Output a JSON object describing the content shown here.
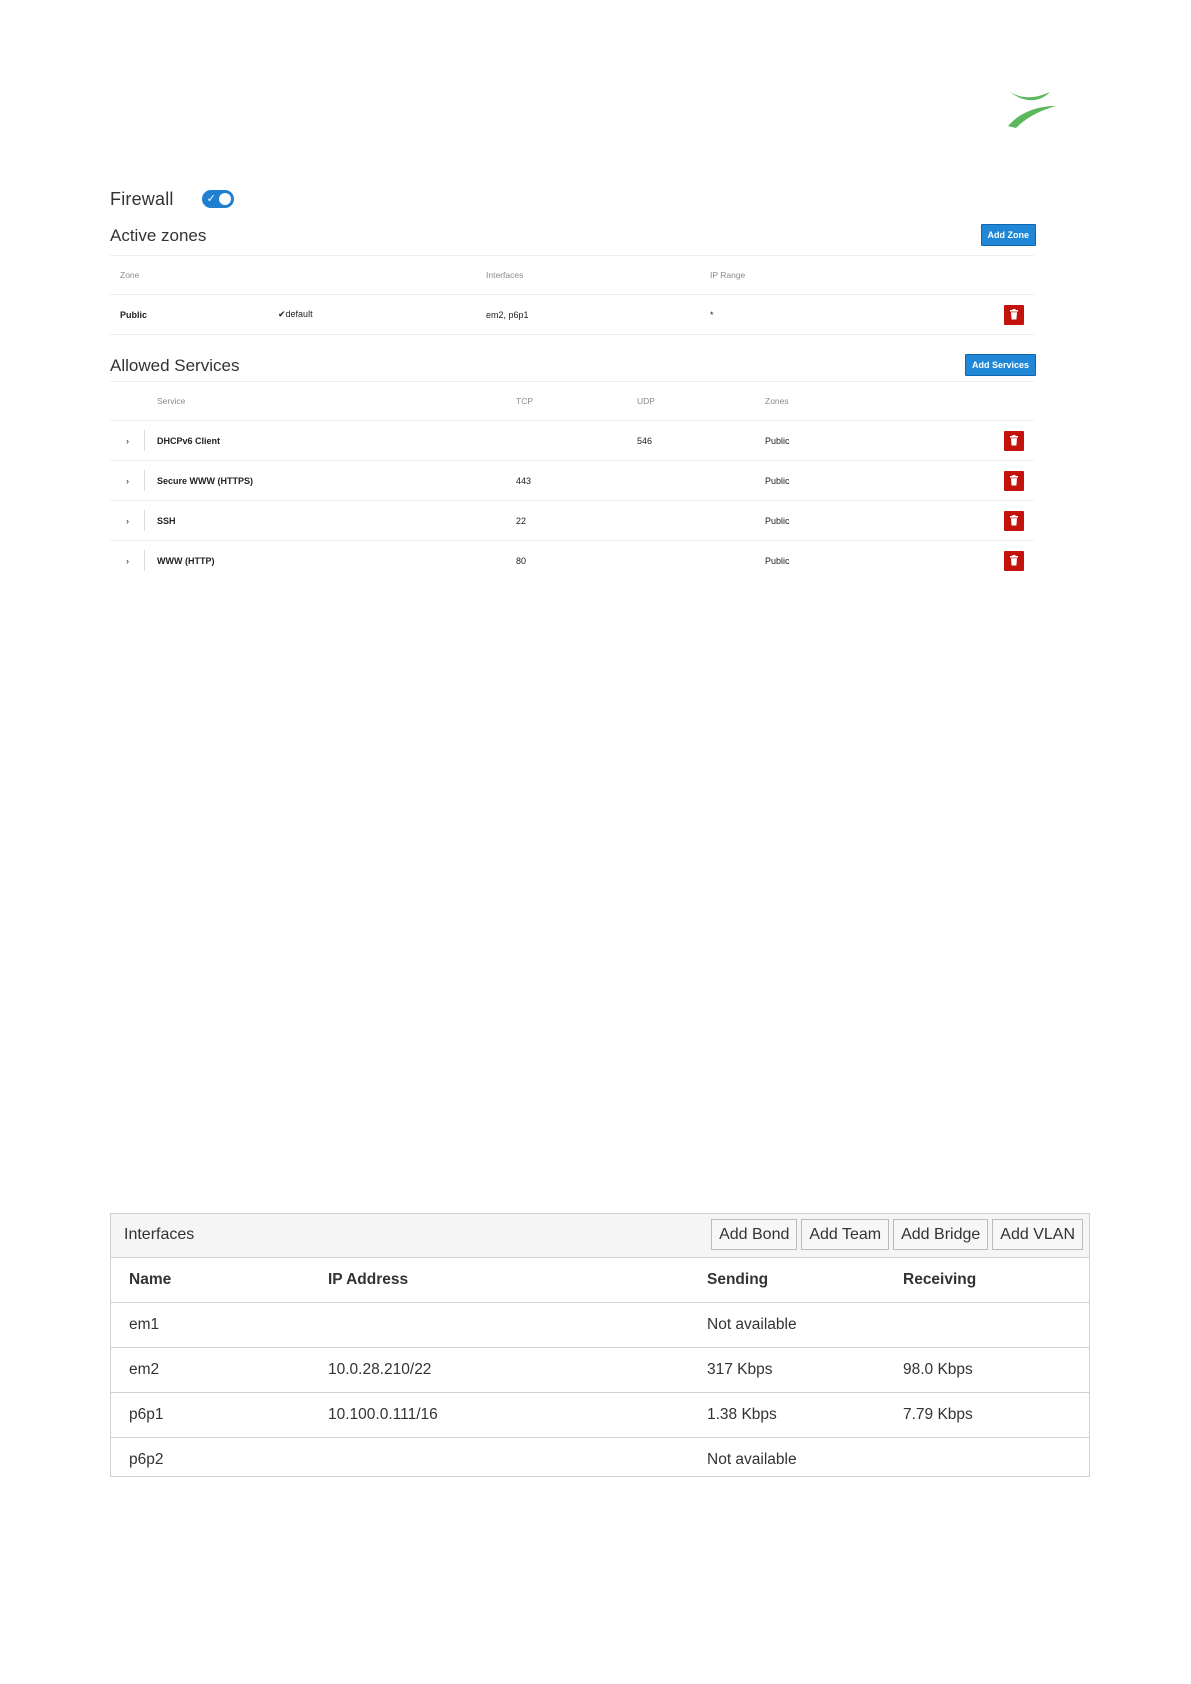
{
  "firewall": {
    "title": "Firewall",
    "enabled": true,
    "toggle_check": "✓"
  },
  "active_zones": {
    "title": "Active zones",
    "add_button": "Add Zone",
    "columns": [
      "Zone",
      "Interfaces",
      "IP Range"
    ],
    "rows": [
      {
        "zone": "Public",
        "default_label": "✔default",
        "interfaces": "em2, p6p1",
        "ip_range": "*"
      }
    ]
  },
  "allowed_services": {
    "title": "Allowed Services",
    "add_button": "Add Services",
    "columns": [
      "Service",
      "TCP",
      "UDP",
      "Zones"
    ],
    "rows": [
      {
        "expand": "›",
        "service": "DHCPv6 Client",
        "tcp": "",
        "udp": "546",
        "zones": "Public"
      },
      {
        "expand": "›",
        "service": "Secure WWW (HTTPS)",
        "tcp": "443",
        "udp": "",
        "zones": "Public"
      },
      {
        "expand": "›",
        "service": "SSH",
        "tcp": "22",
        "udp": "",
        "zones": "Public"
      },
      {
        "expand": "›",
        "service": "WWW (HTTP)",
        "tcp": "80",
        "udp": "",
        "zones": "Public"
      }
    ]
  },
  "interfaces": {
    "title": "Interfaces",
    "buttons": [
      "Add Bond",
      "Add Team",
      "Add Bridge",
      "Add VLAN"
    ],
    "columns": [
      "Name",
      "IP Address",
      "Sending",
      "Receiving"
    ],
    "rows": [
      {
        "name": "em1",
        "ip": "",
        "sending": "Not available",
        "receiving": ""
      },
      {
        "name": "em2",
        "ip": "10.0.28.210/22",
        "sending": "317 Kbps",
        "receiving": "98.0 Kbps"
      },
      {
        "name": "p6p1",
        "ip": "10.100.0.111/16",
        "sending": "1.38 Kbps",
        "receiving": "7.79 Kbps"
      },
      {
        "name": "p6p2",
        "ip": "",
        "sending": "Not available",
        "receiving": ""
      }
    ]
  },
  "colors": {
    "accent": "#1f87d6",
    "danger": "#c4120c",
    "logo": "#5cb85c"
  }
}
